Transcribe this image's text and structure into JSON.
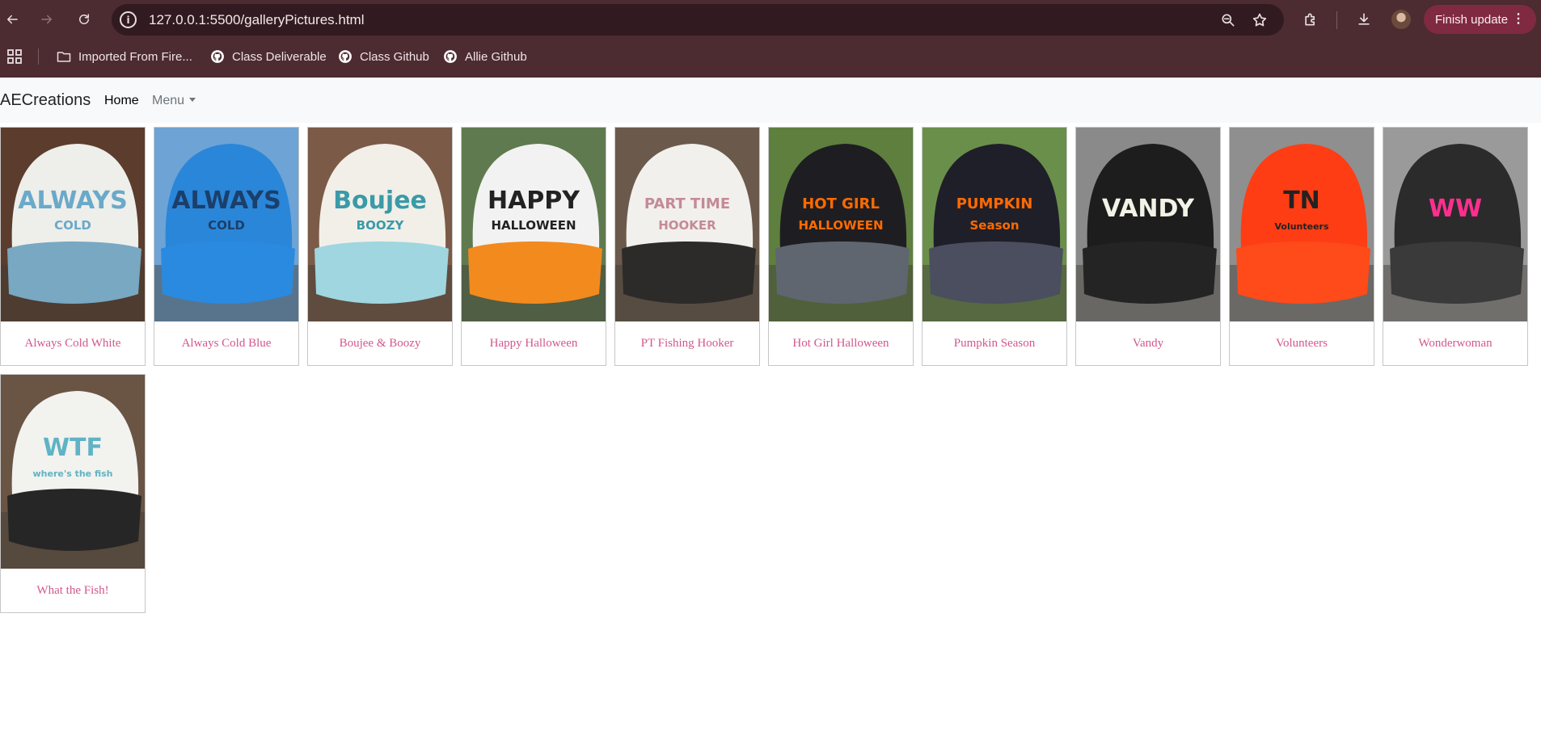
{
  "browser": {
    "url": "127.0.0.1:5500/galleryPictures.html",
    "finish_update_label": "Finish update",
    "bookmarks": [
      "Imported From Fire...",
      "Class Deliverable",
      "Class Github",
      "Allie Github"
    ],
    "icons": [
      "back-icon",
      "forward-icon",
      "reload-icon",
      "site-info-icon",
      "zoom-icon",
      "star-icon",
      "extensions-icon",
      "download-icon",
      "apps-grid-icon",
      "folder-icon",
      "github-icon"
    ]
  },
  "navbar": {
    "brand": "AECreations",
    "home": "Home",
    "menu": "Menu"
  },
  "gallery": [
    {
      "caption": "Always Cold White",
      "hat_text": "ALWAYS",
      "hat_sub": "COLD",
      "front": "#eeeeea",
      "bill": "#78a8c2",
      "text_color": "#6aa9c9",
      "bg": "#5b3c2d"
    },
    {
      "caption": "Always Cold Blue",
      "hat_text": "ALWAYS",
      "hat_sub": "COLD",
      "front": "#2a86d8",
      "bill": "#2a8ae0",
      "text_color": "#1b3f6b",
      "bg": "#6ea3d6"
    },
    {
      "caption": "Boujee & Boozy",
      "hat_text": "Boujee",
      "hat_sub": "BOOZY",
      "front": "#f1efe8",
      "bill": "#9fd6df",
      "text_color": "#3a9aa8",
      "bg": "#7b5a48"
    },
    {
      "caption": "Happy Halloween",
      "hat_text": "HAPPY",
      "hat_sub": "HALLOWEEN",
      "front": "#f2f2f2",
      "bill": "#f28a1e",
      "text_color": "#222222",
      "bg": "#5f7a4f"
    },
    {
      "caption": "PT Fishing Hooker",
      "hat_text": "PART TIME",
      "hat_sub": "HOOKER",
      "front": "#f2f0ec",
      "bill": "#2d2a2a",
      "text_color": "#c48a96",
      "bg": "#6b5a4b"
    },
    {
      "caption": "Hot Girl Halloween",
      "hat_text": "HOT GIRL",
      "hat_sub": "HALLOWEEN",
      "front": "#1e1e22",
      "bill": "#5f6670",
      "text_color": "#ff6a00",
      "bg": "#5f7f3e"
    },
    {
      "caption": "Pumpkin Season",
      "hat_text": "PUMPKIN",
      "hat_sub": "Season",
      "front": "#1f1f29",
      "bill": "#4a4e5e",
      "text_color": "#ff6a00",
      "bg": "#6a8f4a"
    },
    {
      "caption": "Vandy",
      "hat_text": "VANDY",
      "hat_sub": "",
      "front": "#1d1d1d",
      "bill": "#242424",
      "text_color": "#f2f2e6",
      "bg": "#8a8a8a"
    },
    {
      "caption": "Volunteers",
      "hat_text": "TN",
      "hat_sub": "Volunteers",
      "front": "#ff3d14",
      "bill": "#ff4a1a",
      "text_color": "#222222",
      "bg": "#8f8f8f"
    },
    {
      "caption": "Wonderwoman",
      "hat_text": "WW",
      "hat_sub": "",
      "front": "#2b2b2b",
      "bill": "#3a3a3a",
      "text_color": "#ff2f8f",
      "bg": "#9a9a9a"
    },
    {
      "caption": "What the Fish!",
      "hat_text": "WTF",
      "hat_sub": "where's the fish",
      "front": "#f2f2ef",
      "bill": "#262626",
      "text_color": "#5fb3c4",
      "bg": "#6a5444"
    }
  ]
}
